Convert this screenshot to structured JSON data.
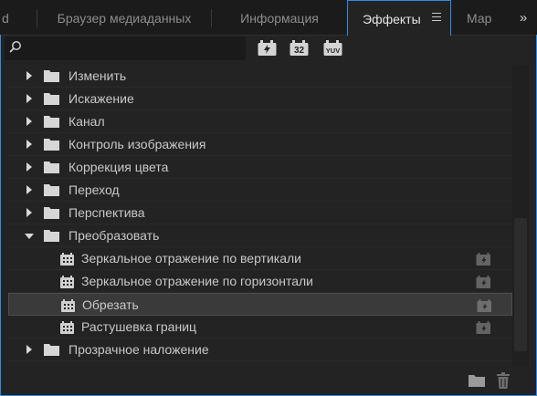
{
  "tabs": [
    {
      "label": "d",
      "active": false
    },
    {
      "label": "Браузер медиаданных",
      "active": false
    },
    {
      "label": "Информация",
      "active": false
    },
    {
      "label": "Эффекты",
      "active": true
    },
    {
      "label": "Мар",
      "active": false
    }
  ],
  "overflow_label": "»",
  "search": {
    "value": "",
    "placeholder": ""
  },
  "filter_buttons": [
    {
      "icon": "accelerated-effects-icon"
    },
    {
      "icon": "32bit-effects-icon",
      "text": "32"
    },
    {
      "icon": "yuv-effects-icon",
      "text": "YUV"
    }
  ],
  "tree": [
    {
      "label": "Изменить",
      "type": "folder",
      "expanded": false
    },
    {
      "label": "Искажение",
      "type": "folder",
      "expanded": false
    },
    {
      "label": "Канал",
      "type": "folder",
      "expanded": false
    },
    {
      "label": "Контроль изображения",
      "type": "folder",
      "expanded": false
    },
    {
      "label": "Коррекция цвета",
      "type": "folder",
      "expanded": false
    },
    {
      "label": "Переход",
      "type": "folder",
      "expanded": false
    },
    {
      "label": "Перспектива",
      "type": "folder",
      "expanded": false
    },
    {
      "label": "Преобразовать",
      "type": "folder",
      "expanded": true
    },
    {
      "label": "Зеркальное отражение по вертикали",
      "type": "effect",
      "selected": false
    },
    {
      "label": "Зеркальное отражение по горизонтали",
      "type": "effect",
      "selected": false
    },
    {
      "label": "Обрезать",
      "type": "effect",
      "selected": true
    },
    {
      "label": "Растушевка границ",
      "type": "effect",
      "selected": false
    },
    {
      "label": "Прозрачное наложение",
      "type": "folder",
      "expanded": false
    }
  ],
  "colors": {
    "accent": "#2d8ceb",
    "background": "#232323",
    "selected_row": "#3a3a3a"
  }
}
